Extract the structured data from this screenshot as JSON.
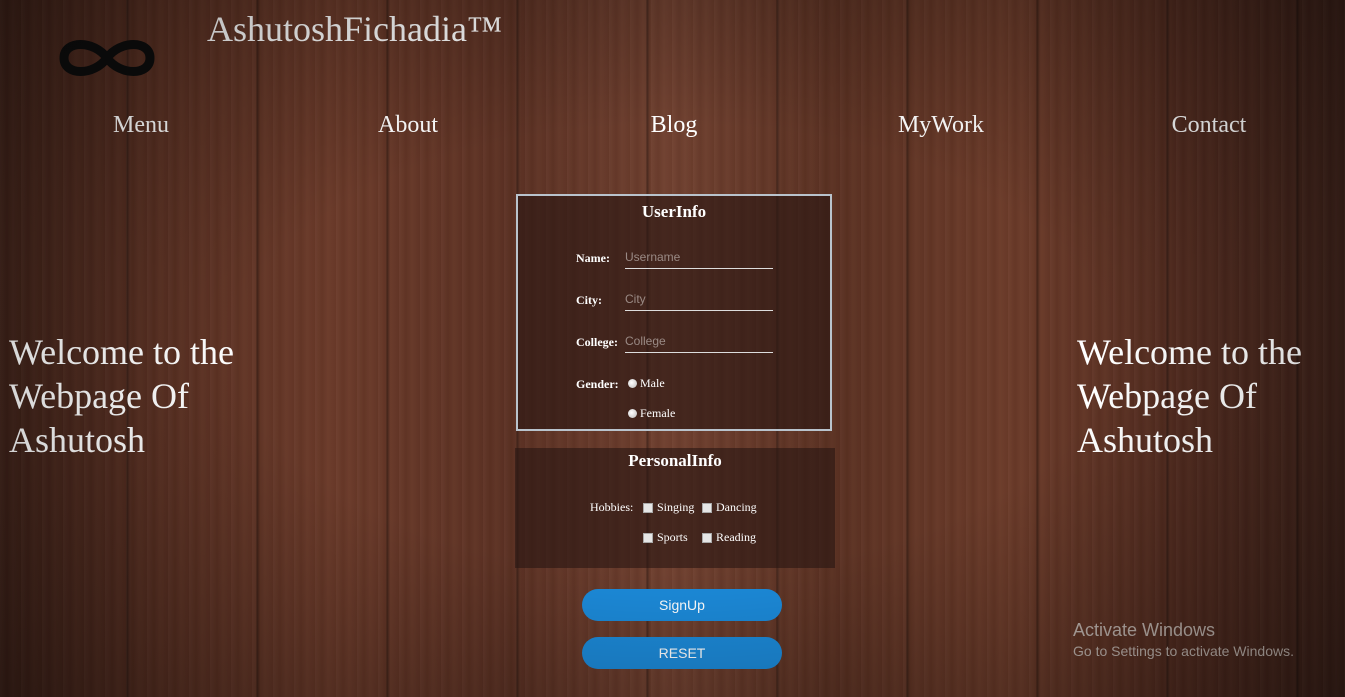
{
  "header": {
    "logo_icon": "infinity-icon",
    "title": "AshutoshFichadia™"
  },
  "nav": {
    "items": [
      {
        "label": "Menu"
      },
      {
        "label": "About"
      },
      {
        "label": "Blog"
      },
      {
        "label": "MyWork"
      },
      {
        "label": "Contact"
      }
    ]
  },
  "welcome": {
    "left_text": "Welcome to the Webpage Of Ashutosh",
    "right_text": "Welcome to the Webpage Of Ashutosh"
  },
  "user_info": {
    "title": "UserInfo",
    "name_label": "Name:",
    "name_placeholder": "Username",
    "city_label": "City:",
    "city_placeholder": "City",
    "college_label": "College:",
    "college_placeholder": "College",
    "gender_label": "Gender:",
    "gender_options": [
      "Male",
      "Female"
    ]
  },
  "personal_info": {
    "title": "PersonalInfo",
    "hobbies_label": "Hobbies:",
    "hobbies": [
      "Singing",
      "Dancing",
      "Sports",
      "Reading"
    ]
  },
  "buttons": {
    "signup_label": "SignUp",
    "reset_label": "RESET",
    "color": "#1c8ad9"
  },
  "watermark": {
    "line1": "Activate Windows",
    "line2": "Go to Settings to activate Windows."
  }
}
